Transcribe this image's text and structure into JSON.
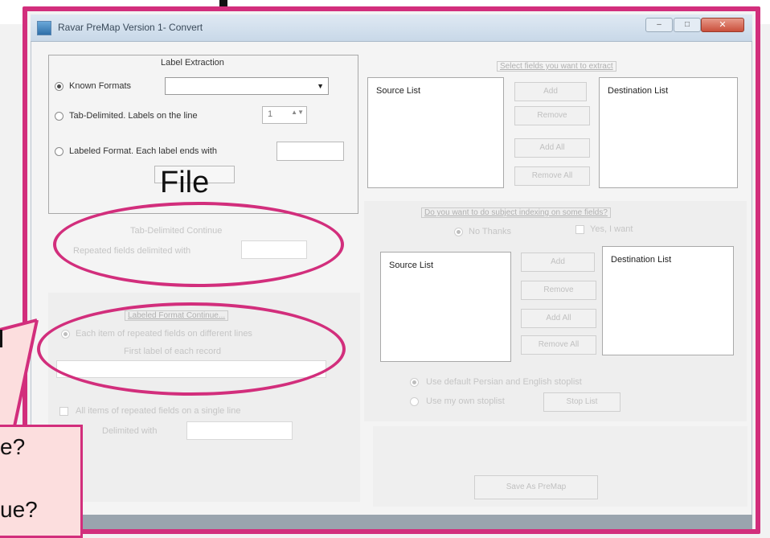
{
  "window": {
    "title": "Ravar PreMap Version 1- Convert",
    "close_glyph": "✕",
    "min_glyph": "–",
    "max_glyph": "□"
  },
  "label_extraction": {
    "group_title": "Label Extraction",
    "known_formats_label": "Known Formats",
    "known_formats_value": "",
    "tab_delimited_label": "Tab-Delimited. Labels on the line",
    "tab_lines_value": "1",
    "labeled_format_label": "Labeled Format. Each label ends with",
    "labeled_format_value": "",
    "overlay_file_text": "File"
  },
  "tab_continue": {
    "group_title": "Tab-Delimited Continue",
    "repeated_fields_label": "Repeated fields delimited with",
    "repeated_fields_value": ""
  },
  "labeled_continue": {
    "group_title": "Labeled Format Continue...",
    "each_item_label": "Each item of repeated fields on different lines",
    "first_label_text": "First label of each record",
    "first_label_value": "",
    "all_items_label": "All items of repeated fields on a single line",
    "delimited_with_label": "Delimited with",
    "delimited_with_value": ""
  },
  "field_select": {
    "prompt": "Select fields you want to extract",
    "source_header": "Source List",
    "destination_header": "Destination List",
    "add": "Add",
    "remove": "Remove",
    "add_all": "Add All",
    "remove_all": "Remove All"
  },
  "subject_index": {
    "prompt": "Do you want to do subject indexing on some fields?",
    "no_thanks": "No Thanks",
    "yes_want": "Yes, I want",
    "source_header": "Source List",
    "destination_header": "Destination List",
    "add": "Add",
    "remove": "Remove",
    "add_all": "Add All",
    "remove_all": "Remove All",
    "use_default_stoplist": "Use default Persian and English stoplist",
    "use_own_stoplist": "Use my own stoplist",
    "stop_list_button": "Stop List"
  },
  "footer": {
    "save_button": "Save As PreMap"
  },
  "callout": {
    "line1": "e?",
    "line2": "ue?"
  },
  "colors": {
    "annotation": "#d22e7c",
    "callout_fill": "#fcdede",
    "window_bg": "#f4f4f4"
  }
}
